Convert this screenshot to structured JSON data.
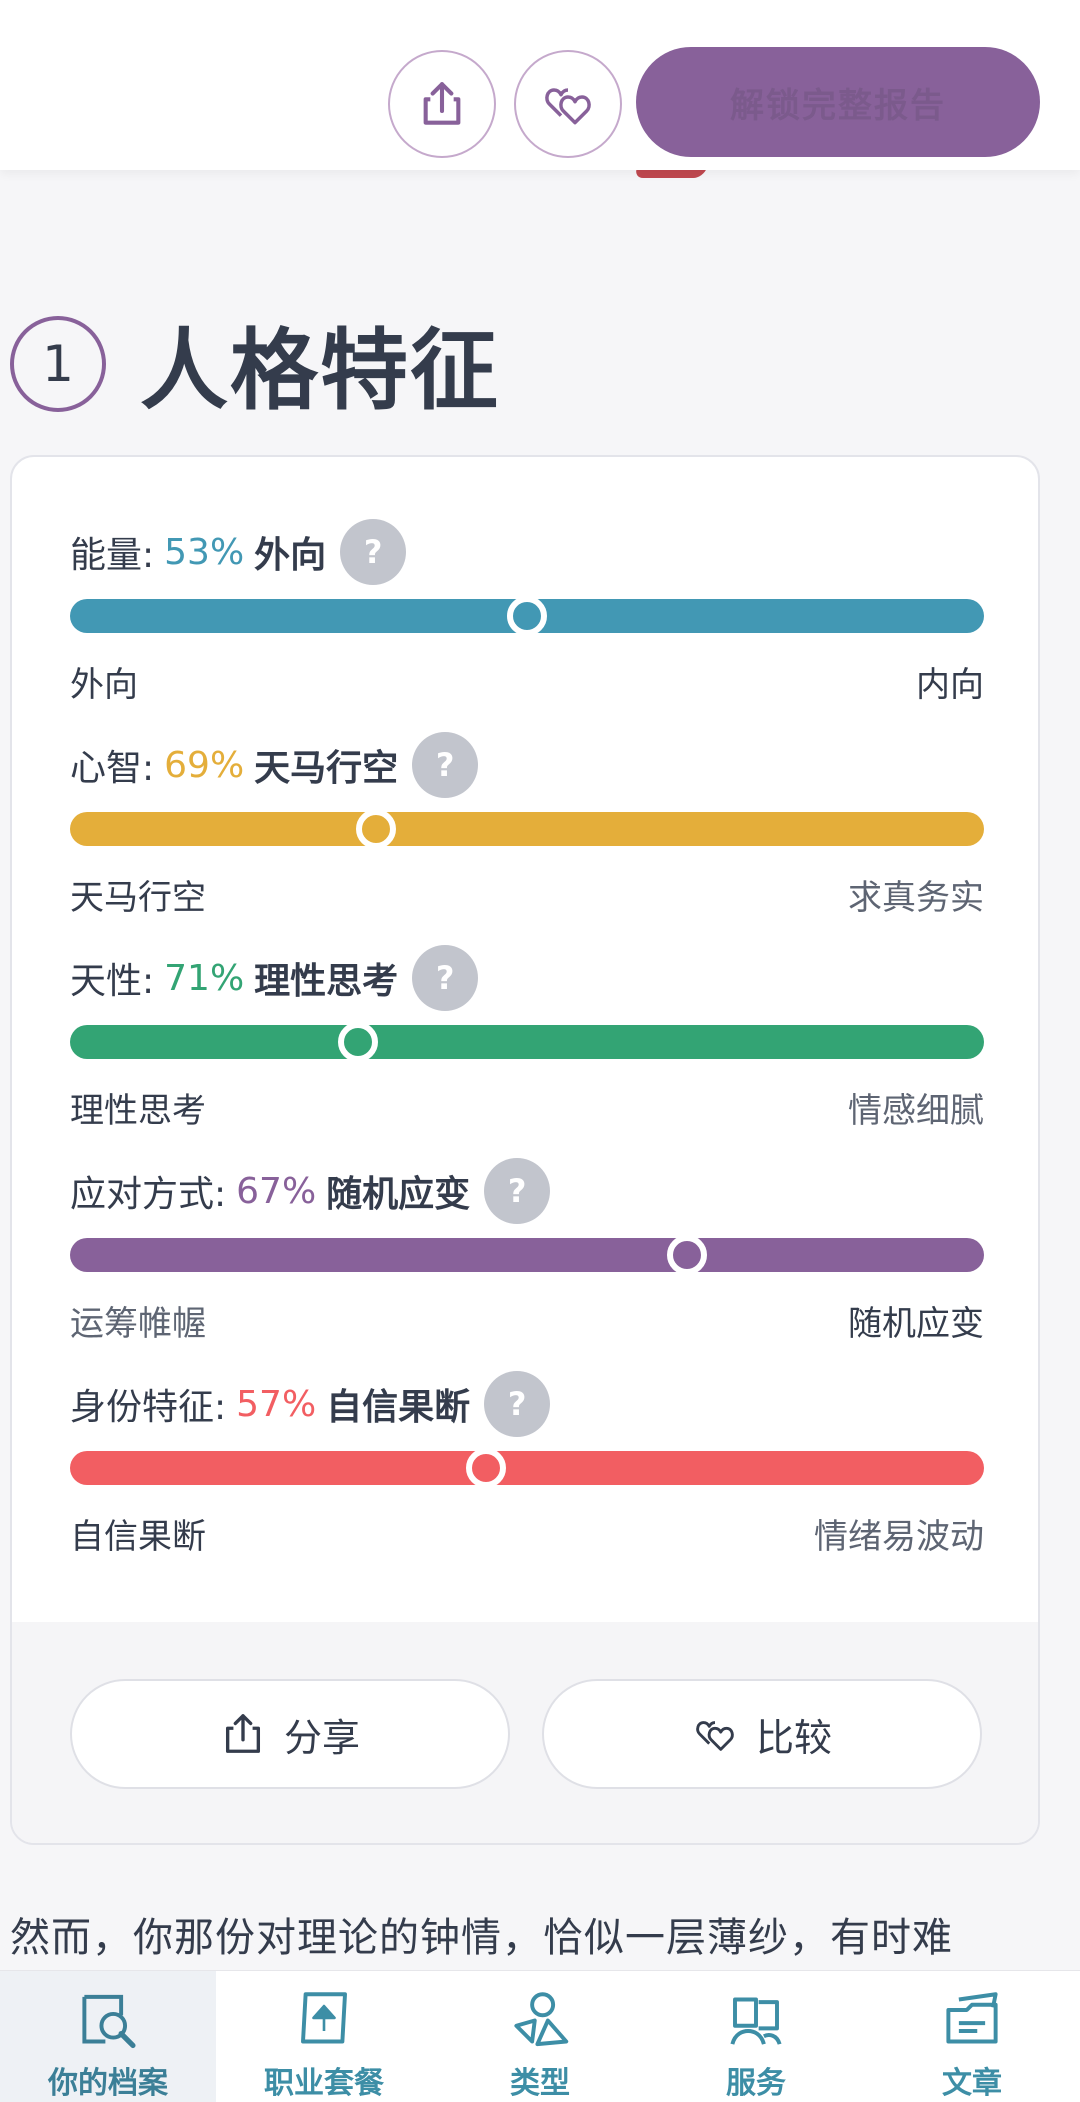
{
  "header": {
    "share_icon": "share-icon",
    "compare_icon": "hearts-icon",
    "cta_label": "解锁完整报告"
  },
  "section": {
    "number": "1",
    "title": "人格特征"
  },
  "traits": [
    {
      "name": "能量:",
      "percent": "53%",
      "side": "外向",
      "left": "外向",
      "right": "内向",
      "left_muted": false,
      "right_muted": false,
      "knob_position": 0.5,
      "color": "#4298b4"
    },
    {
      "name": "心智:",
      "percent": "69%",
      "side": "天马行空",
      "left": "天马行空",
      "right": "求真务实",
      "left_muted": false,
      "right_muted": true,
      "knob_position": 0.335,
      "color": "#e4ae3a"
    },
    {
      "name": "天性:",
      "percent": "71%",
      "side": "理性思考",
      "left": "理性思考",
      "right": "情感细腻",
      "left_muted": false,
      "right_muted": true,
      "knob_position": 0.315,
      "color": "#33a474"
    },
    {
      "name": "应对方式:",
      "percent": "67%",
      "side": "随机应变",
      "left": "运筹帷幄",
      "right": "随机应变",
      "left_muted": true,
      "right_muted": false,
      "knob_position": 0.675,
      "color": "#88619a"
    },
    {
      "name": "身份特征:",
      "percent": "57%",
      "side": "自信果断",
      "left": "自信果断",
      "right": "情绪易波动",
      "left_muted": false,
      "right_muted": true,
      "knob_position": 0.455,
      "color": "#f25e62"
    }
  ],
  "actions": {
    "share_label": "分享",
    "compare_label": "比较"
  },
  "paragraph": "然而，你那份对理论的钟情，恰似一层薄纱，有时难",
  "bottom_nav": [
    {
      "label": "你的档案",
      "icon": "profile-search-icon",
      "active": true
    },
    {
      "label": "职业套餐",
      "icon": "career-icon",
      "active": false
    },
    {
      "label": "类型",
      "icon": "shapes-icon",
      "active": false
    },
    {
      "label": "服务",
      "icon": "people-icon",
      "active": false
    },
    {
      "label": "文章",
      "icon": "folder-icon",
      "active": false
    }
  ]
}
